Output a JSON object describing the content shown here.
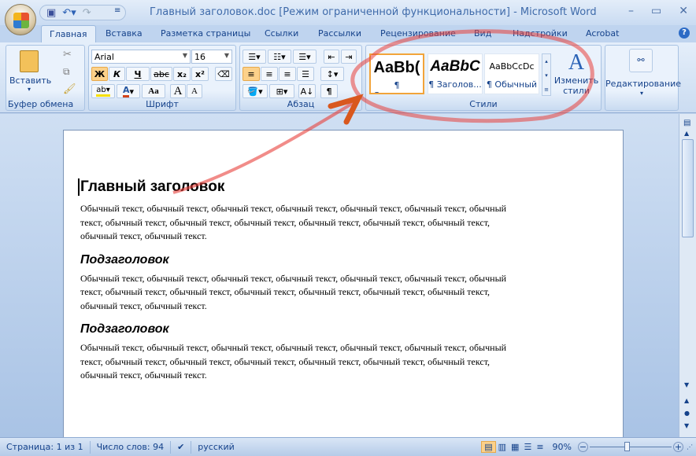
{
  "window": {
    "title": "Главный заголовок.doc [Режим ограниченной функциональности] - Microsoft Word"
  },
  "tabs": [
    "Главная",
    "Вставка",
    "Разметка страницы",
    "Ссылки",
    "Рассылки",
    "Рецензирование",
    "Вид",
    "Надстройки",
    "Acrobat"
  ],
  "ribbon": {
    "clipboard": {
      "paste": "Вставить",
      "label": "Буфер обмена"
    },
    "font": {
      "name": "Arial",
      "size": "16",
      "bold": "Ж",
      "italic": "К",
      "underline": "Ч",
      "strike": "abc",
      "sub": "x₂",
      "sup": "x²",
      "case": "Aa",
      "grow": "A",
      "shrink": "A",
      "label": "Шрифт"
    },
    "paragraph": {
      "label": "Абзац",
      "pilcrow": "¶"
    },
    "styles": {
      "items": [
        {
          "preview": "AaBb(",
          "name": "¶ Заголов..."
        },
        {
          "preview": "AaBbC",
          "name": "¶ Заголов..."
        },
        {
          "preview": "AaBbCcDc",
          "name": "¶ Обычный"
        }
      ],
      "change": "Изменить стили",
      "label": "Стили"
    },
    "editing": {
      "label": "Редактирование"
    }
  },
  "document": {
    "heading": "Главный заголовок",
    "paragraph1": "Обычный текст, обычный текст, обычный текст, обычный текст, обычный текст, обычный текст, обычный текст, обычный текст, обычный текст, обычный текст, обычный текст, обычный текст, обычный текст, обычный текст, обычный текст.",
    "sub1": "Подзаголовок",
    "paragraph2": "Обычный текст, обычный текст, обычный текст, обычный текст, обычный текст, обычный текст, обычный текст, обычный текст, обычный текст, обычный текст, обычный текст, обычный текст, обычный текст, обычный текст, обычный текст.",
    "sub2": "Подзаголовок",
    "paragraph3": "Обычный текст, обычный текст, обычный текст, обычный текст, обычный текст, обычный текст, обычный текст, обычный текст, обычный текст, обычный текст, обычный текст, обычный текст, обычный текст, обычный текст, обычный текст."
  },
  "status": {
    "page": "Страница: 1 из 1",
    "words": "Число слов: 94",
    "language": "русский",
    "zoom": "90%",
    "zoom_fraction": 0.45
  },
  "colors": {
    "annotation": "#e8403a",
    "accent": "#15428b"
  }
}
